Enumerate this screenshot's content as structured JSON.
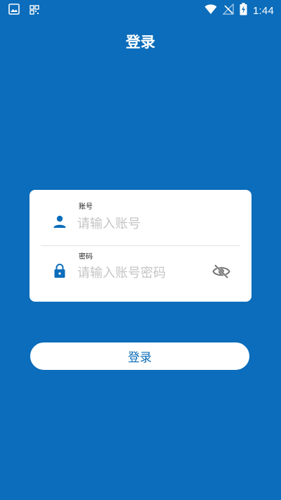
{
  "status_bar": {
    "time": "1:44",
    "left_icons": [
      "image-icon",
      "qr-scan-icon"
    ],
    "right_icons": [
      "wifi-icon",
      "no-signal-icon",
      "battery-charging-icon"
    ]
  },
  "header": {
    "title": "登录"
  },
  "form": {
    "username": {
      "label": "账号",
      "placeholder": "请输入账号",
      "value": "",
      "icon": "person-icon"
    },
    "password": {
      "label": "密码",
      "placeholder": "请输入账号密码",
      "value": "",
      "icon": "lock-icon",
      "toggle_icon": "eye-off-icon"
    }
  },
  "actions": {
    "login_label": "登录"
  },
  "colors": {
    "background": "#0B6DBB",
    "card": "#FFFFFF",
    "accent": "#0B6DBB",
    "placeholder": "#C4C4C4",
    "icon_gray": "#757575"
  }
}
